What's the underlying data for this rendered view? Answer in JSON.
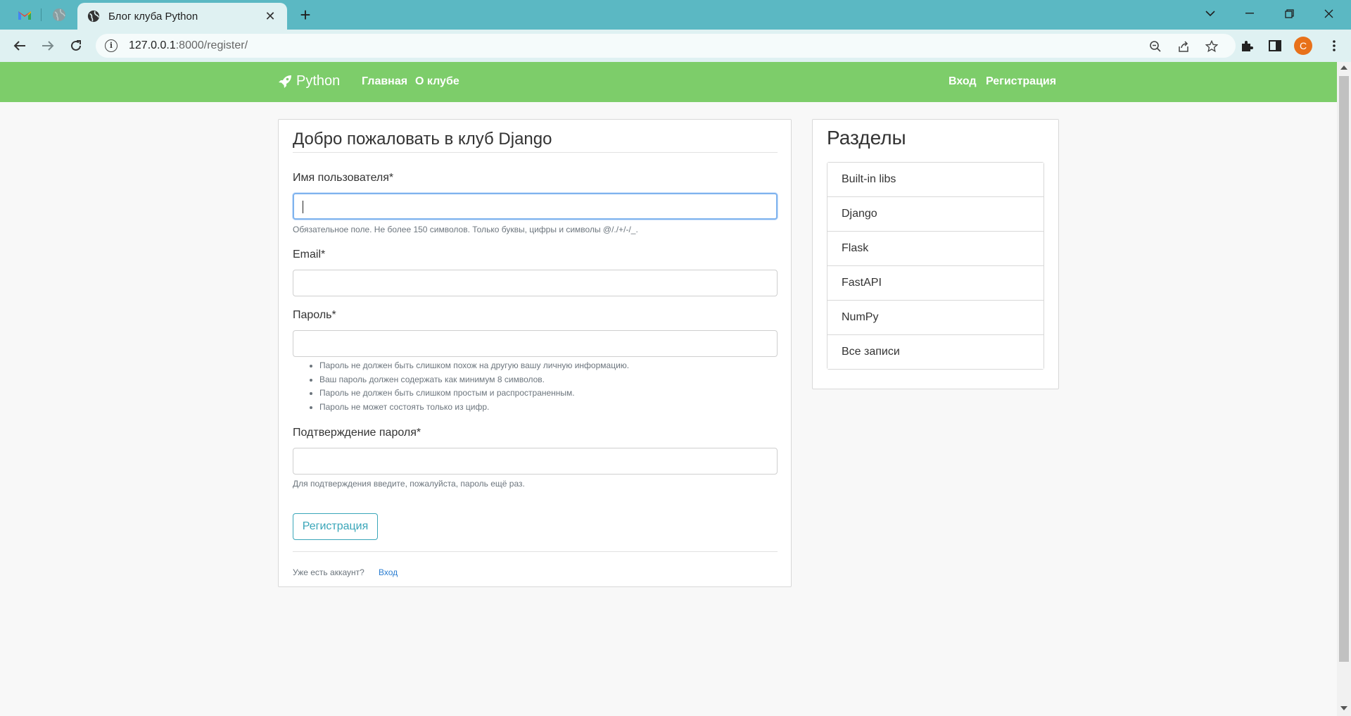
{
  "browser": {
    "active_tab_title": "Блог клуба Python",
    "url_host": "127.0.0.1",
    "url_path": ":8000/register/",
    "profile_initial": "C"
  },
  "site": {
    "brand": "Python",
    "nav_left": [
      "Главная",
      "О клубе"
    ],
    "nav_right": [
      "Вход",
      "Регистрация"
    ]
  },
  "form": {
    "title": "Добро пожаловать в клуб Django",
    "username_label": "Имя пользователя*",
    "username_value": "",
    "username_help": "Обязательное поле. Не более 150 символов. Только буквы, цифры и символы @/./+/-/_.",
    "email_label": "Email*",
    "email_value": "",
    "password_label": "Пароль*",
    "password_value": "",
    "password_rules": [
      "Пароль не должен быть слишком похож на другую вашу личную информацию.",
      "Ваш пароль должен содержать как минимум 8 символов.",
      "Пароль не должен быть слишком простым и распространенным.",
      "Пароль не может состоять только из цифр."
    ],
    "password2_label": "Подтверждение пароля*",
    "password2_value": "",
    "password2_help": "Для подтверждения введите, пожалуйста, пароль ещё раз.",
    "submit_label": "Регистрация",
    "have_account_text": "Уже есть аккаунт?",
    "login_link": "Вход"
  },
  "sections": {
    "title": "Разделы",
    "items": [
      "Built-in libs",
      "Django",
      "Flask",
      "FastAPI",
      "NumPy",
      "Все записи"
    ]
  },
  "colors": {
    "tabbar": "#5bb8c3",
    "toolbar": "#dff1f2",
    "navbar": "#7dcd6a",
    "button_accent": "#3aa6b9",
    "link": "#2a7dd1",
    "avatar": "#e8711a"
  }
}
